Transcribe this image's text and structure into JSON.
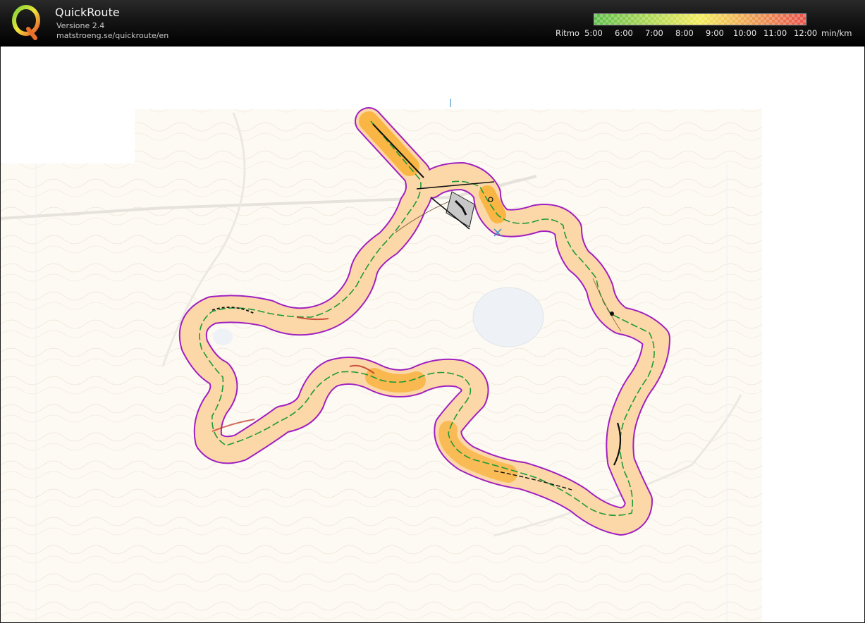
{
  "app": {
    "name": "QuickRoute",
    "version": "Versione 2.4",
    "url": "matstroeng.se/quickroute/en"
  },
  "logo": {
    "letter": "Q",
    "icon": "quickroute-logo-icon"
  },
  "pace_legend": {
    "label": "Ritmo",
    "unit": "min/km",
    "ticks": [
      "5:00",
      "6:00",
      "7:00",
      "8:00",
      "9:00",
      "10:00",
      "11:00",
      "12:00"
    ],
    "colors": {
      "fast": "#5fbf4a",
      "medium": "#f4ec5a",
      "slow": "#e8504a"
    }
  },
  "route": {
    "outline_color": "#a020c0",
    "fill_color": "#fcd8a8",
    "fast_color": "#f8b23a"
  }
}
